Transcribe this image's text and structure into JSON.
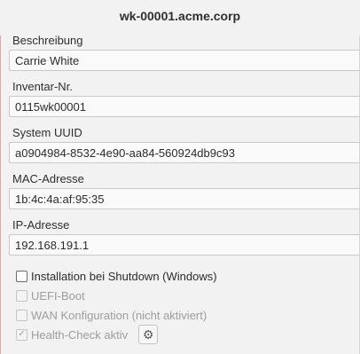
{
  "window": {
    "title": "wk-00001.acme.corp"
  },
  "fields": [
    {
      "label": "Beschreibung",
      "value": "Carrie White"
    },
    {
      "label": "Inventar-Nr.",
      "value": "0115wk00001"
    },
    {
      "label": "System UUID",
      "value": "a0904984-8532-4e90-aa84-560924db9c93"
    },
    {
      "label": "MAC-Adresse",
      "value": "1b:4c:4a:af:95:35"
    },
    {
      "label": "IP-Adresse",
      "value": "192.168.191.1"
    }
  ],
  "checkboxes": [
    {
      "label": "Installation bei Shutdown (Windows)",
      "checked": false,
      "enabled": true
    },
    {
      "label": "UEFI-Boot",
      "checked": false,
      "enabled": false
    },
    {
      "label": "WAN Konfiguration (nicht aktiviert)",
      "checked": false,
      "enabled": false
    },
    {
      "label": "Health-Check aktiv",
      "checked": true,
      "enabled": false
    }
  ],
  "icons": {
    "settings": "gear-icon",
    "check": "checkmark-icon"
  },
  "colors": {
    "background": "#f2f2f2",
    "input_background": "#fafafa",
    "disabled_text": "#9d9d9d"
  }
}
